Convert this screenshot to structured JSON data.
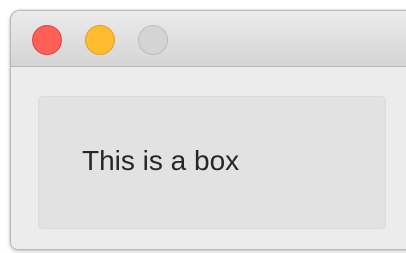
{
  "window": {
    "controls": {
      "close": {
        "icon": "close-circle-icon",
        "color": "#fe5f57"
      },
      "minimize": {
        "icon": "minimize-circle-icon",
        "color": "#febc2e"
      },
      "zoom": {
        "icon": "zoom-circle-icon",
        "color": "#d4d4d4",
        "state": "disabled"
      }
    }
  },
  "content": {
    "box_label": "This is a box"
  }
}
